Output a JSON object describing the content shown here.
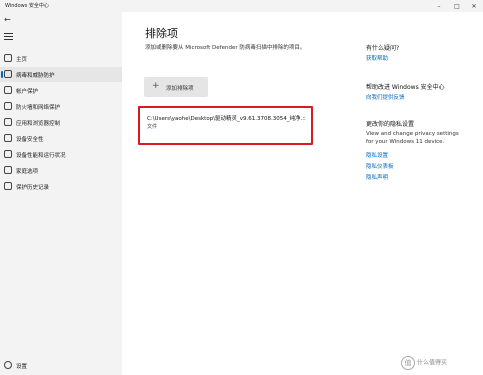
{
  "window": {
    "title": "Windows 安全中心"
  },
  "sidebar": {
    "items": [
      {
        "label": "主页",
        "icon": "home-icon"
      },
      {
        "label": "病毒和威胁防护",
        "icon": "shield-icon",
        "active": true
      },
      {
        "label": "帐户保护",
        "icon": "person-icon"
      },
      {
        "label": "防火墙和网络保护",
        "icon": "wifi-icon"
      },
      {
        "label": "应用和浏览器控制",
        "icon": "app-window-icon"
      },
      {
        "label": "设备安全性",
        "icon": "device-icon"
      },
      {
        "label": "设备性能和运行状况",
        "icon": "heart-icon"
      },
      {
        "label": "家庭选项",
        "icon": "family-icon"
      },
      {
        "label": "保护历史记录",
        "icon": "history-icon"
      }
    ],
    "settings_label": "设置"
  },
  "main": {
    "title": "排除项",
    "description": "添加或删除要从 Microsoft Defender 防病毒扫描中排除的项目。",
    "add_button": "添加排除项",
    "exclusion": {
      "path": "C:\\Users\\yaohe\\Desktop\\驱动精灵_v9.61.3708.3054_纯净...",
      "type": "文件"
    }
  },
  "right_panel": {
    "question_heading": "有什么疑问?",
    "help_link": "获取帮助",
    "improve_heading": "帮助改进 Windows 安全中心",
    "feedback_link": "向我们提供反馈",
    "privacy_heading": "更改你的隐私设置",
    "privacy_text": [
      "View and change privacy settings",
      "for your Windows 11 device."
    ],
    "privacy_links": [
      "隐私设置",
      "隐私仪表板",
      "隐私声明"
    ]
  },
  "watermark": "什么值得买"
}
